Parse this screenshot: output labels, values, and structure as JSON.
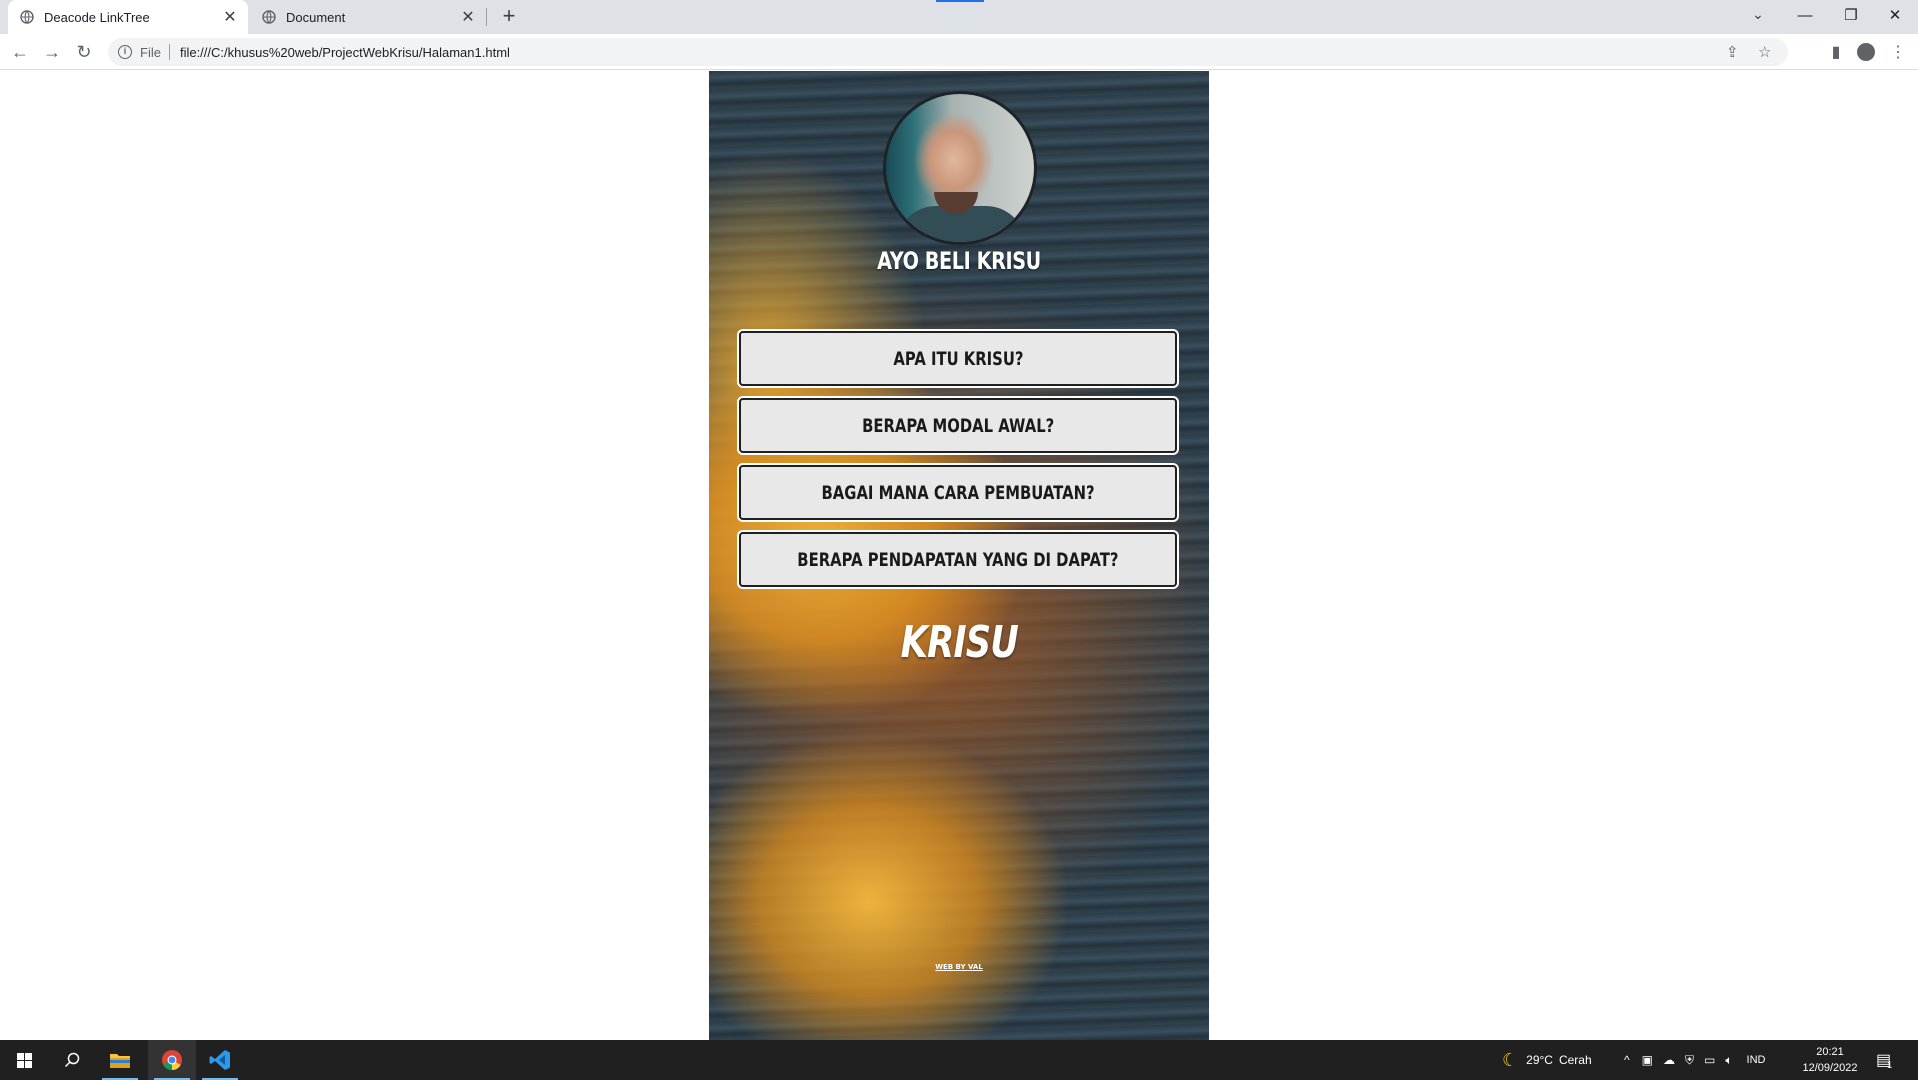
{
  "browser": {
    "tabs": [
      {
        "title": "Deacode LinkTree",
        "active": true
      },
      {
        "title": "Document",
        "active": false
      }
    ],
    "address": {
      "scheme_label": "File",
      "url": "file:///C:/khusus%20web/ProjectWebKrisu/Halaman1.html"
    },
    "accent": "#1a73e8"
  },
  "page": {
    "title": "AYO BELI KRISU",
    "links": [
      {
        "label": "APA ITU KRISU?"
      },
      {
        "label": "BERAPA MODAL AWAL?"
      },
      {
        "label": "BAGAI MANA CARA PEMBUATAN?"
      },
      {
        "label": "BERAPA PENDAPATAN YANG DI DAPAT?"
      }
    ],
    "brand": "KRISU",
    "credit": "WEB BY VAL"
  },
  "taskbar": {
    "weather": {
      "temp": "29°C",
      "condition": "Cerah"
    },
    "language": "IND",
    "time": "20:21",
    "date": "12/09/2022",
    "notification_count": "1"
  }
}
